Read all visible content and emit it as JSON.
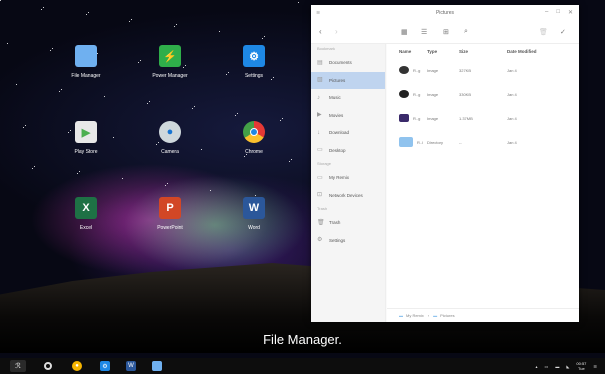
{
  "desktop": {
    "icons": [
      {
        "label": "File Manager",
        "icon": "folder-icon",
        "color": "#6fb0f0"
      },
      {
        "label": "Power Manager",
        "icon": "battery-icon",
        "color": "#2fae4a"
      },
      {
        "label": "Settings",
        "icon": "gear-icon",
        "color": "#1e88e5"
      },
      {
        "label": "Play Store",
        "icon": "play-store-icon",
        "color": "#e8e8e8"
      },
      {
        "label": "Camera",
        "icon": "camera-icon",
        "color": "#cfd8dc"
      },
      {
        "label": "Chrome",
        "icon": "chrome-icon",
        "color": "#e53935"
      },
      {
        "label": "Excel",
        "icon": "excel-icon",
        "color": "#1e7145"
      },
      {
        "label": "PowerPoint",
        "icon": "powerpoint-icon",
        "color": "#d24726"
      },
      {
        "label": "Word",
        "icon": "word-icon",
        "color": "#2b579a"
      }
    ]
  },
  "window": {
    "title": "Pictures",
    "sidebar": {
      "headers": [
        "Bookmark",
        "Storage",
        "Trash"
      ],
      "bookmarks": [
        "Documents",
        "Pictures",
        "Music",
        "Movies",
        "Download",
        "Desktop"
      ],
      "storage": [
        "My Remix",
        "Network Devices"
      ],
      "trash": [
        "Trash",
        "Settings"
      ],
      "active": "Pictures"
    },
    "columns": {
      "name": "Name",
      "type": "Type",
      "size": "Size",
      "date": "Date Modified"
    },
    "files": [
      {
        "name": "R..g",
        "type": "Image",
        "size": "327KB",
        "date": "Jan 4",
        "thumb": "#333"
      },
      {
        "name": "R..g",
        "type": "Image",
        "size": "330KB",
        "date": "Jan 4",
        "thumb": "#222"
      },
      {
        "name": "R..g",
        "type": "Image",
        "size": "1.37MB",
        "date": "Jan 4",
        "thumb": "#3a2a6a"
      },
      {
        "name": "R..l",
        "type": "Directory",
        "size": "--",
        "date": "Jan 4",
        "thumb": "#90c3ee"
      }
    ],
    "breadcrumb": {
      "root": "My Remix",
      "current": "Pictures"
    }
  },
  "subtitle": "File Manager.",
  "taskbar": {
    "clock_time": "00:57",
    "clock_day": "Tue"
  }
}
